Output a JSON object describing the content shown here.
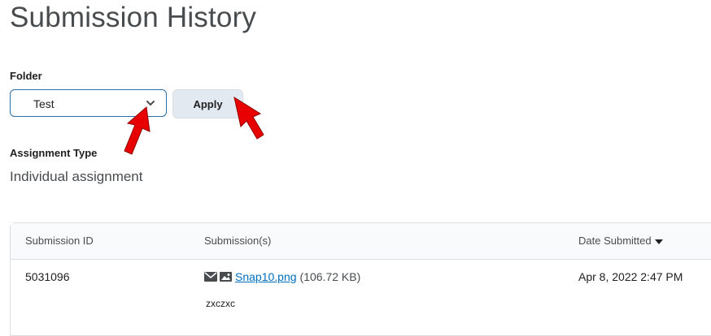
{
  "page": {
    "title": "Submission History"
  },
  "folder": {
    "label": "Folder",
    "selected": "Test"
  },
  "apply": {
    "label": "Apply"
  },
  "assignment_type": {
    "label": "Assignment Type",
    "value": "Individual assignment"
  },
  "table": {
    "headers": {
      "id": "Submission ID",
      "submissions": "Submission(s)",
      "date": "Date Submitted"
    },
    "rows": [
      {
        "id": "5031096",
        "file_name": "Snap10.png",
        "file_size": "(106.72 KB)",
        "comment": "zxczxc",
        "date": "Apr 8, 2022 2:47 PM"
      }
    ]
  },
  "colors": {
    "accent": "#006fbf",
    "border": "#2a6fa8",
    "annotation_arrow": "#e80000"
  },
  "icons": [
    "chevron-down-icon",
    "sort-down-icon",
    "envelope-icon",
    "image-icon",
    "red-arrow-annotation"
  ]
}
